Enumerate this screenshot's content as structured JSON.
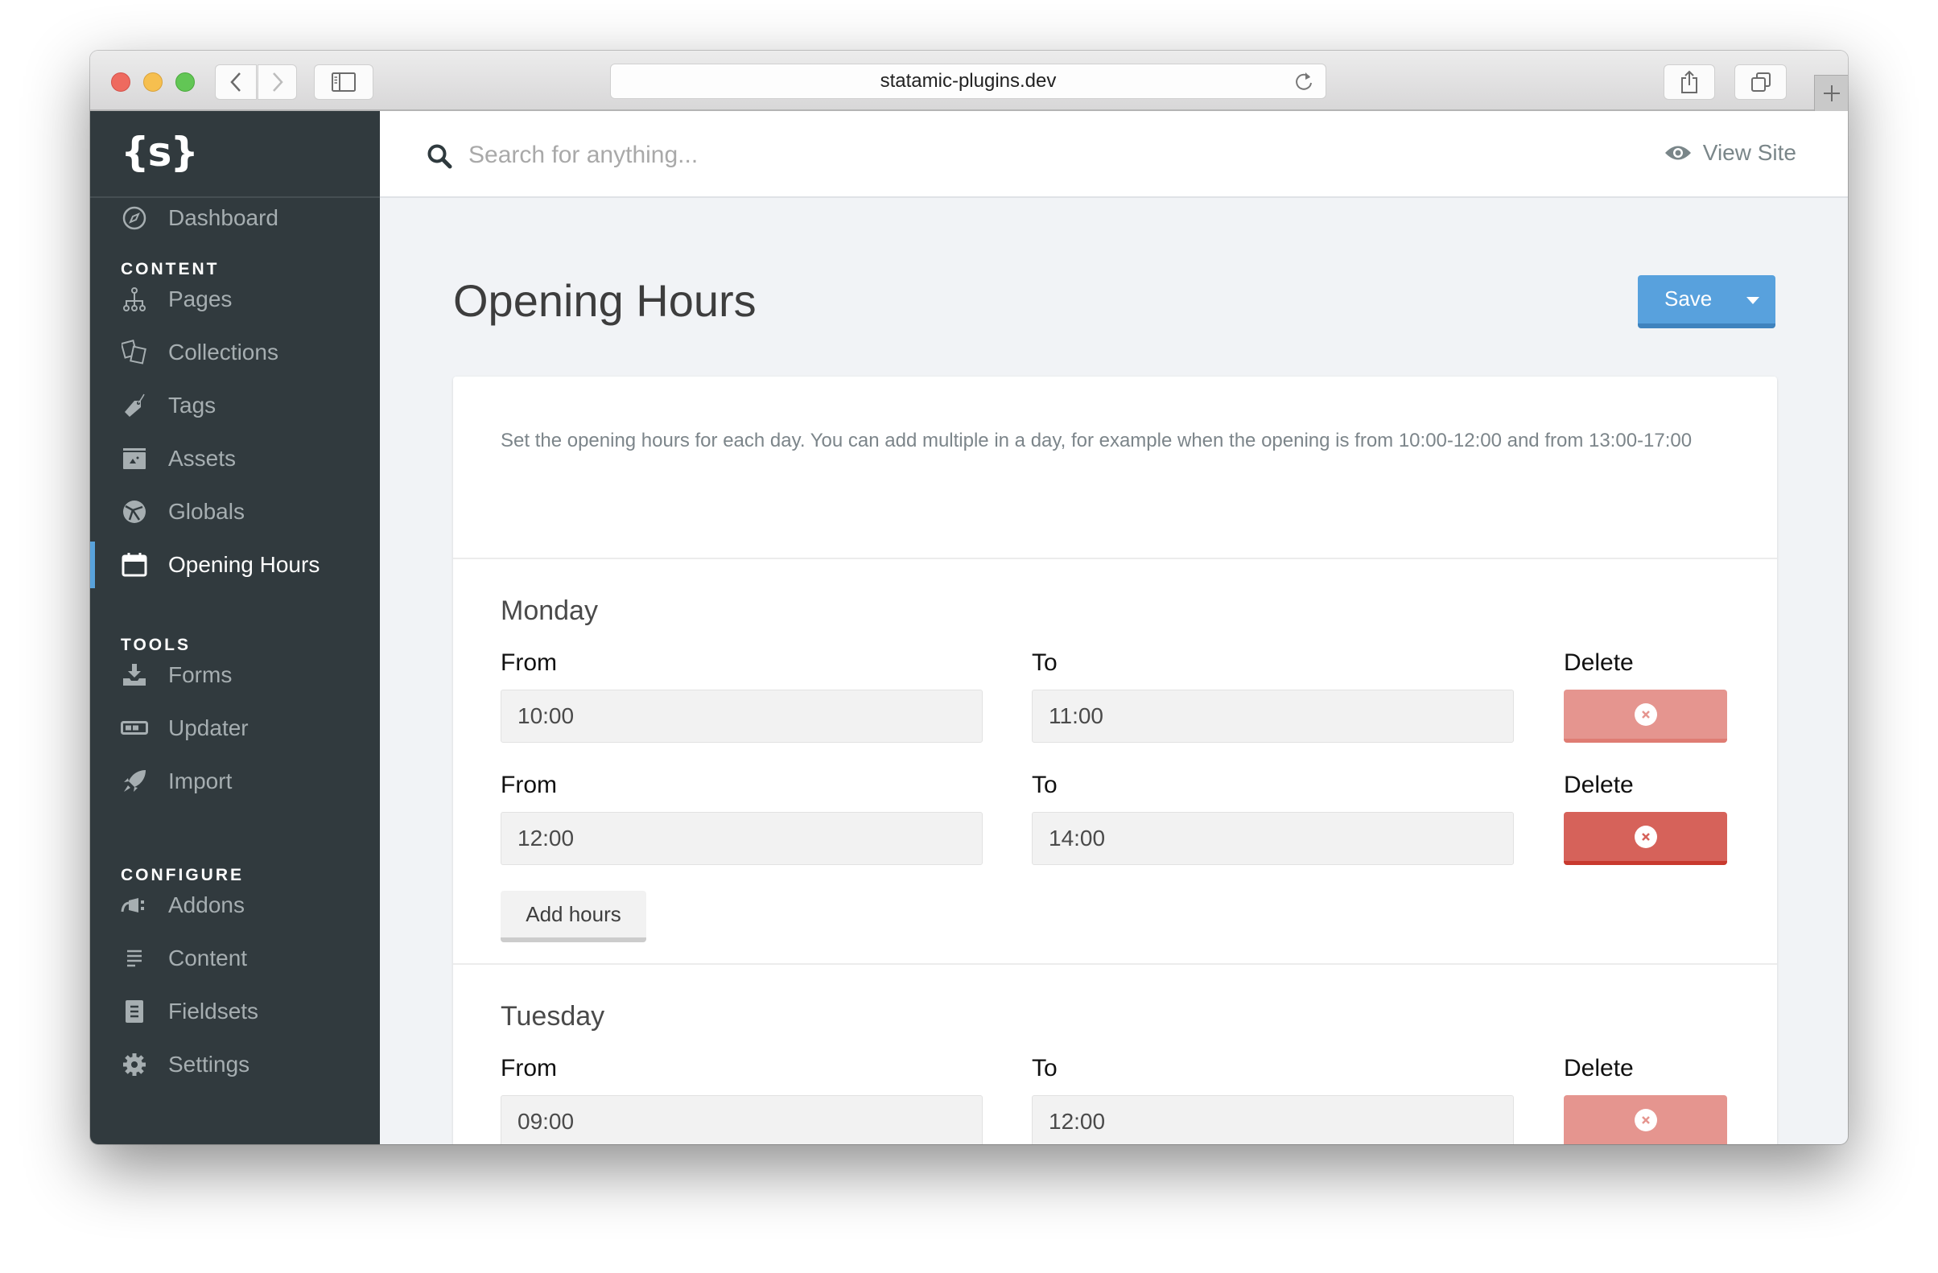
{
  "browser": {
    "url": "statamic-plugins.dev",
    "back_icon": "chevron-left",
    "forward_icon": "chevron-right",
    "sidebar_toggle_icon": "sidebar",
    "reload_icon": "reload",
    "share_icon": "share",
    "tabs_icon": "tabs",
    "new_tab_icon": "plus"
  },
  "sidebar": {
    "logo": "{s}",
    "dashboard": {
      "label": "Dashboard",
      "icon": "compass"
    },
    "sections": [
      {
        "heading": "CONTENT",
        "items": [
          {
            "label": "Pages",
            "icon": "sitemap"
          },
          {
            "label": "Collections",
            "icon": "collections"
          },
          {
            "label": "Tags",
            "icon": "tag"
          },
          {
            "label": "Assets",
            "icon": "image-folder"
          },
          {
            "label": "Globals",
            "icon": "globe"
          },
          {
            "label": "Opening Hours",
            "icon": "calendar",
            "active": true
          }
        ]
      },
      {
        "heading": "TOOLS",
        "items": [
          {
            "label": "Forms",
            "icon": "download-tray"
          },
          {
            "label": "Updater",
            "icon": "progress-bar"
          },
          {
            "label": "Import",
            "icon": "rocket"
          }
        ]
      },
      {
        "heading": "CONFIGURE",
        "items": [
          {
            "label": "Addons",
            "icon": "plug"
          },
          {
            "label": "Content",
            "icon": "lines"
          },
          {
            "label": "Fieldsets",
            "icon": "document"
          },
          {
            "label": "Settings",
            "icon": "gear"
          }
        ]
      }
    ],
    "accent_color": "#59a2db"
  },
  "header": {
    "search_placeholder": "Search for anything...",
    "view_site_label": "View Site"
  },
  "page": {
    "title": "Opening Hours",
    "save_label": "Save",
    "description": "Set the opening hours for each day. You can add multiple in a day, for example when the opening is from 10:00-12:00 and from 13:00-17:00",
    "labels": {
      "from": "From",
      "to": "To",
      "delete": "Delete"
    },
    "add_hours_label": "Add hours",
    "days": [
      {
        "name": "Monday",
        "slots": [
          {
            "from": "10:00",
            "to": "11:00"
          },
          {
            "from": "12:00",
            "to": "14:00"
          }
        ]
      },
      {
        "name": "Tuesday",
        "slots": [
          {
            "from": "09:00",
            "to": "12:00"
          }
        ]
      }
    ]
  },
  "colors": {
    "primary": "#58a1dd",
    "danger": "#d6625a",
    "danger_light": "#e5958f",
    "sidebar_bg": "#313a3e"
  }
}
